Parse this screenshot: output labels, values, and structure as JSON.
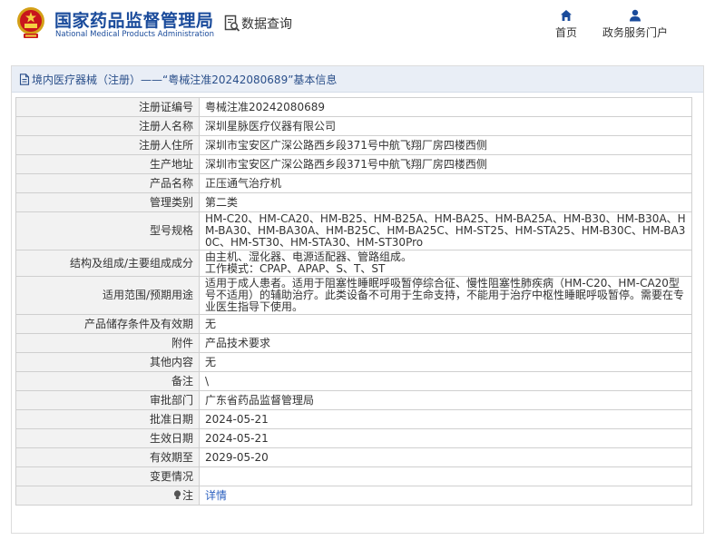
{
  "header": {
    "brand_cn": "国家药品监督管理局",
    "brand_en": "National Medical Products Administration",
    "data_query": "数据查询",
    "nav": [
      {
        "label": "首页",
        "icon": "home-icon"
      },
      {
        "label": "政务服务门户",
        "icon": "user-icon"
      }
    ]
  },
  "page": {
    "title": "境内医疗器械（注册）——“粤械注准20242080689”基本信息"
  },
  "rows": [
    {
      "label": "注册证编号",
      "value": "粤械注准20242080689"
    },
    {
      "label": "注册人名称",
      "value": "深圳星脉医疗仪器有限公司"
    },
    {
      "label": "注册人住所",
      "value": "深圳市宝安区广深公路西乡段371号中航飞翔厂房四楼西侧"
    },
    {
      "label": "生产地址",
      "value": "深圳市宝安区广深公路西乡段371号中航飞翔厂房四楼西侧"
    },
    {
      "label": "产品名称",
      "value": "正压通气治疗机"
    },
    {
      "label": "管理类别",
      "value": "第二类"
    },
    {
      "label": "型号规格",
      "value": "HM-C20、HM-CA20、HM-B25、HM-B25A、HM-BA25、HM-BA25A、HM-B30、HM-B30A、HM-BA30、HM-BA30A、HM-B25C、HM-BA25C、HM-ST25、HM-STA25、HM-B30C、HM-BA30C、HM-ST30、HM-STA30、HM-ST30Pro"
    },
    {
      "label": "结构及组成/主要组成成分",
      "value": "由主机、湿化器、电源适配器、管路组成。",
      "value2": "工作模式：CPAP、APAP、S、T、ST"
    },
    {
      "label": "适用范围/预期用途",
      "value": "适用于成人患者。适用于阻塞性睡眠呼吸暂停综合征、慢性阻塞性肺疾病（HM-C20、HM-CA20型号不适用）的辅助治疗。此类设备不可用于生命支持，不能用于治疗中枢性睡眠呼吸暂停。需要在专业医生指导下使用。"
    },
    {
      "label": "产品储存条件及有效期",
      "value": "无"
    },
    {
      "label": "附件",
      "value": "产品技术要求"
    },
    {
      "label": "其他内容",
      "value": "无"
    },
    {
      "label": "备注",
      "value": "\\"
    },
    {
      "label": "审批部门",
      "value": "广东省药品监督管理局"
    },
    {
      "label": "批准日期",
      "value": "2024-05-21"
    },
    {
      "label": "生效日期",
      "value": "2024-05-21"
    },
    {
      "label": "有效期至",
      "value": "2029-05-20"
    },
    {
      "label": "变更情况",
      "value": ""
    },
    {
      "label": "注",
      "value": "详情"
    }
  ]
}
